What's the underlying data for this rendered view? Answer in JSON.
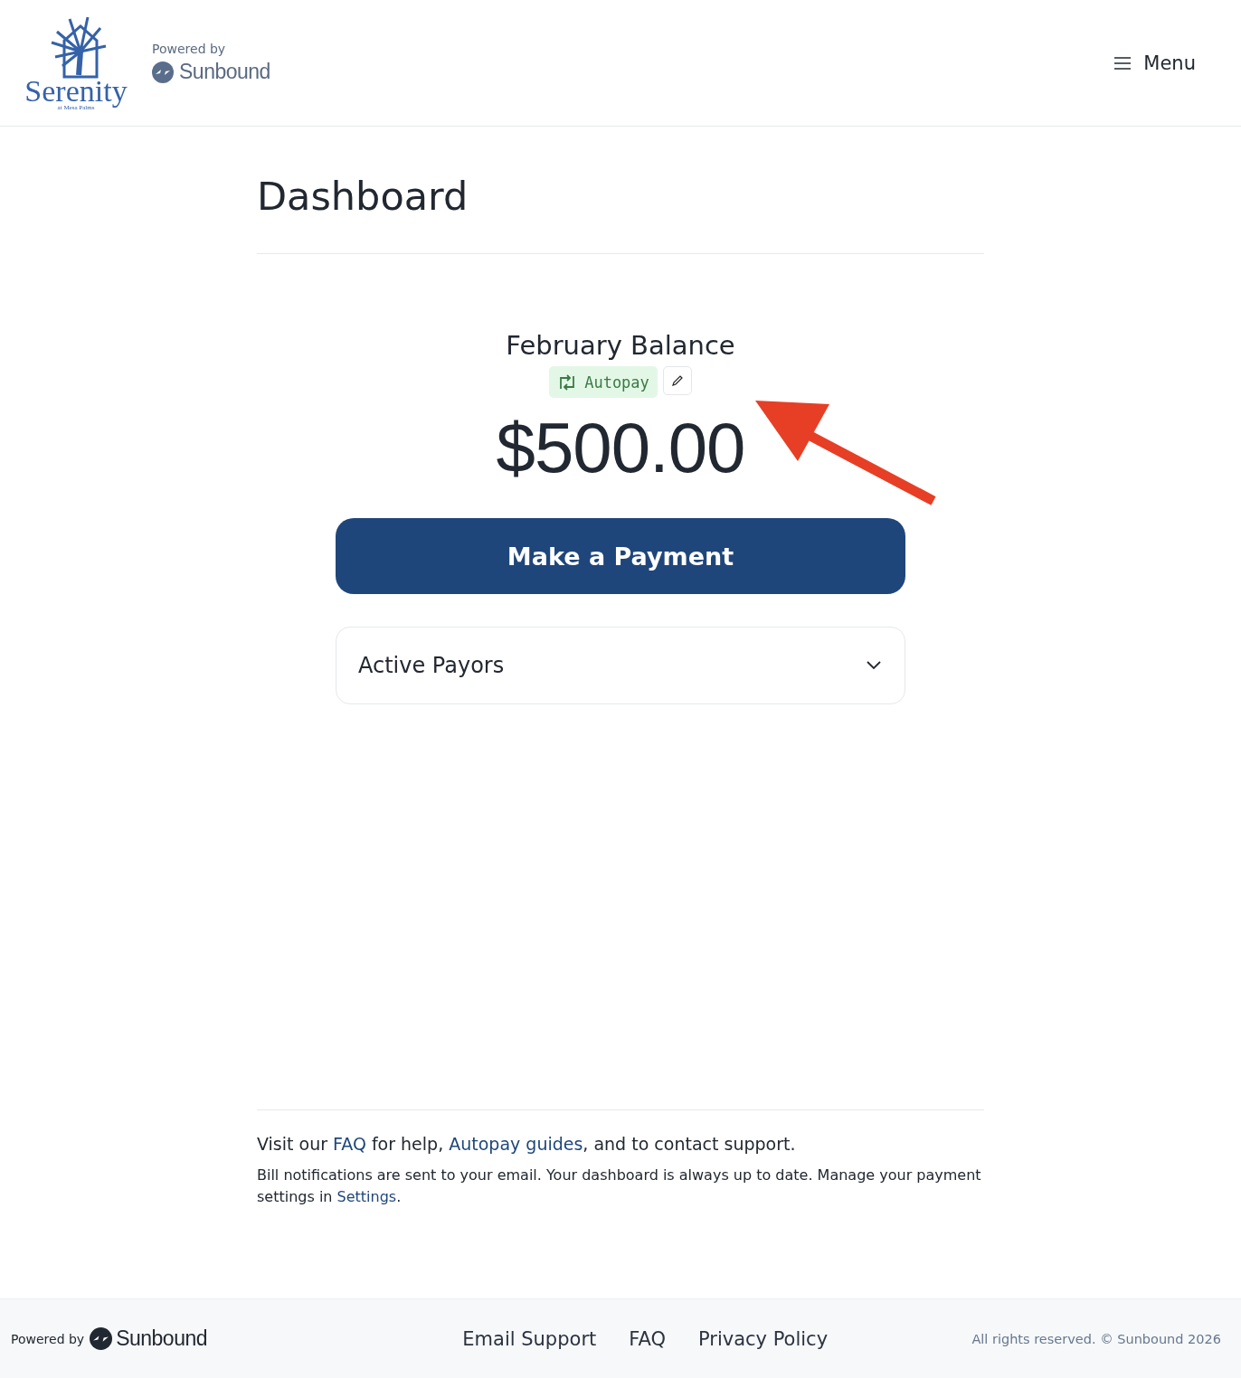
{
  "header": {
    "logo": {
      "name": "Serenity",
      "tagline": "at Mesa Palms"
    },
    "powered_by": "Powered by",
    "brand": "Sunbound",
    "menu_label": "Menu"
  },
  "page_title": "Dashboard",
  "balance": {
    "title": "February Balance",
    "autopay": {
      "label": "Autopay",
      "on": true
    },
    "amount": "$500.00"
  },
  "pay_button": "Make a Payment",
  "accordion": {
    "title": "Active Payors",
    "expanded": false
  },
  "help": {
    "line": [
      {
        "kind": "text",
        "text": "Visit our "
      },
      {
        "kind": "link",
        "text": "FAQ"
      },
      {
        "kind": "text",
        "text": " for help, "
      },
      {
        "kind": "link",
        "text": "Autopay guides"
      },
      {
        "kind": "text",
        "text": ", and to contact support."
      }
    ],
    "note": [
      {
        "kind": "text",
        "text": "Bill notifications are sent to your email. Your dashboard is always up to date. Manage your payment settings in "
      },
      {
        "kind": "link",
        "text": "Settings"
      },
      {
        "kind": "text",
        "text": "."
      }
    ]
  },
  "footer": {
    "powered_by": "Powered by",
    "brand": "Sunbound",
    "links": [
      "Email Support",
      "FAQ",
      "Privacy Policy"
    ],
    "copyright": "All rights reserved. © Sunbound 2026"
  }
}
